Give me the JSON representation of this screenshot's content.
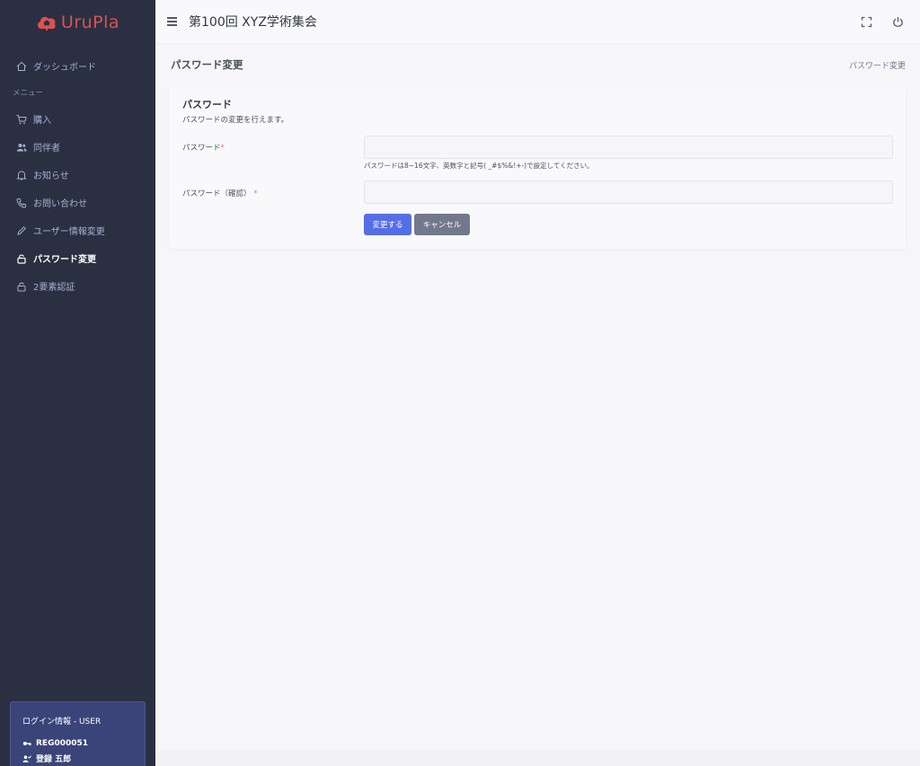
{
  "brand": {
    "name": "UruPla",
    "color": "#d9534f"
  },
  "header": {
    "title": "第100回 XYZ学術集会"
  },
  "sidebar": {
    "dashboard": "ダッシュボード",
    "menu_title": "メニュー",
    "items": [
      {
        "label": "購入",
        "icon": "cart-icon"
      },
      {
        "label": "同伴者",
        "icon": "users-icon"
      },
      {
        "label": "お知らせ",
        "icon": "bell-icon"
      },
      {
        "label": "お問い合わせ",
        "icon": "phone-icon"
      },
      {
        "label": "ユーザー情報変更",
        "icon": "pencil-icon"
      },
      {
        "label": "パスワード変更",
        "icon": "lock-icon",
        "active": true
      },
      {
        "label": "2要素認証",
        "icon": "lock-icon"
      }
    ]
  },
  "login_info": {
    "title": "ログイン情報 - USER",
    "id": "REG000051",
    "name": "登録 五郎"
  },
  "page": {
    "title": "パスワード変更",
    "breadcrumb": "パスワード変更"
  },
  "form": {
    "title": "パスワード",
    "description": "パスワードの変更を行えます。",
    "password_label": "パスワード",
    "password_value": "",
    "confirm_label": "パスワード（確認）",
    "confirm_value": "",
    "required_mark": "*",
    "help_text": "パスワードは8~16文字、英数字と記号( _#$%&!+-)で設定してください。",
    "submit_label": "変更する",
    "cancel_label": "キャンセル"
  },
  "colors": {
    "sidebar_bg": "#2a3042",
    "primary": "#556ee6",
    "secondary": "#74788d",
    "login_card": "#3a4478"
  }
}
